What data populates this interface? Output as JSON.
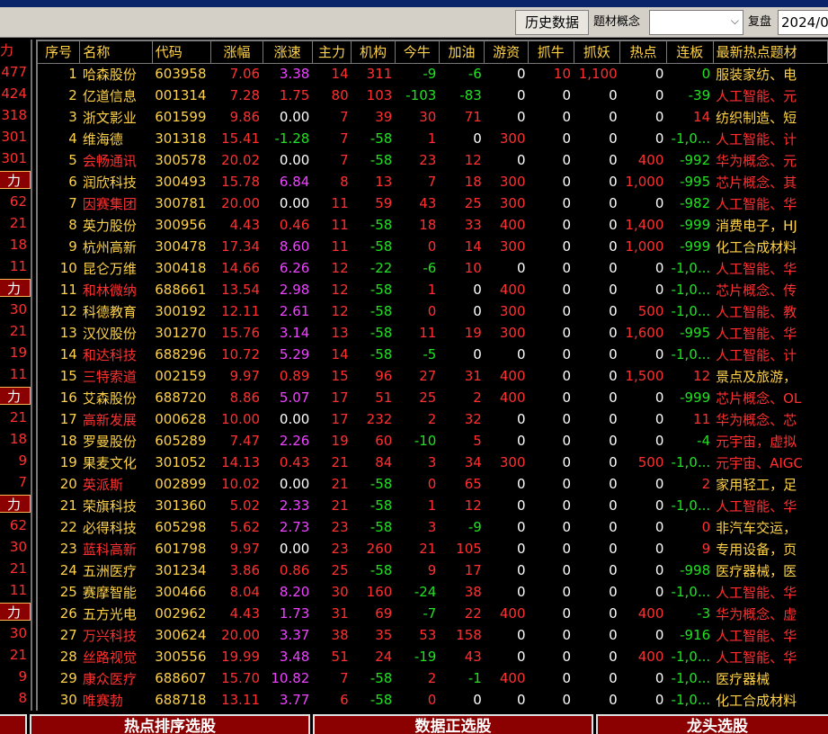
{
  "toolbar": {
    "history_button": "历史数据",
    "theme_label": "题材概念",
    "theme_select_value": "",
    "review_label": "复盘",
    "date_value": "2024/0"
  },
  "left_column": [
    {
      "text": "力",
      "badge": true,
      "top": true
    },
    {
      "text": "477"
    },
    {
      "text": "424"
    },
    {
      "text": "318"
    },
    {
      "text": "301"
    },
    {
      "text": "301"
    },
    {
      "text": "力",
      "badge": true
    },
    {
      "text": "62"
    },
    {
      "text": "21"
    },
    {
      "text": "18"
    },
    {
      "text": "11"
    },
    {
      "text": "力",
      "badge": true
    },
    {
      "text": "30"
    },
    {
      "text": "21"
    },
    {
      "text": "19"
    },
    {
      "text": "11"
    },
    {
      "text": "力",
      "badge": true
    },
    {
      "text": "21"
    },
    {
      "text": "18"
    },
    {
      "text": "9"
    },
    {
      "text": "7"
    },
    {
      "text": "力",
      "badge": true
    },
    {
      "text": "62"
    },
    {
      "text": "30"
    },
    {
      "text": "21"
    },
    {
      "text": "11"
    },
    {
      "text": "力",
      "badge": true
    },
    {
      "text": "30"
    },
    {
      "text": "21"
    },
    {
      "text": "9"
    },
    {
      "text": "8"
    }
  ],
  "table": {
    "headers": [
      "序号",
      "名称",
      "代码",
      "涨幅",
      "涨速",
      "主力",
      "机构",
      "今牛",
      "加油",
      "游资",
      "抓牛",
      "抓妖",
      "热点",
      "连板",
      "最新热点题材"
    ],
    "rows": [
      {
        "idx": "1",
        "name": "哈森股份",
        "nc": "y",
        "code": "603958",
        "chg": "7.06",
        "spd": "3.38",
        "sc": "m",
        "zl": "14",
        "jg": "311",
        "jgc": "r",
        "jn": "-9",
        "jnc": "g",
        "jy": "-6",
        "jyc": "g",
        "yz": "0",
        "zn": "10",
        "znc": "r",
        "zy": "1,100",
        "zyc": "r",
        "rd": "0",
        "lb": "0",
        "lbc": "g",
        "theme": "服装家纺、电",
        "tc": "y"
      },
      {
        "idx": "2",
        "name": "亿道信息",
        "nc": "y",
        "code": "001314",
        "chg": "7.28",
        "spd": "1.75",
        "sc": "r",
        "zl": "80",
        "jg": "103",
        "jgc": "r",
        "jn": "-103",
        "jnc": "g",
        "jy": "-83",
        "jyc": "g",
        "yz": "0",
        "zn": "0",
        "znc": "w",
        "zy": "0",
        "zyc": "w",
        "rd": "0",
        "lb": "-39",
        "lbc": "g",
        "theme": "人工智能、元",
        "tc": "r"
      },
      {
        "idx": "3",
        "name": "浙文影业",
        "nc": "y",
        "code": "601599",
        "chg": "9.86",
        "spd": "0.00",
        "sc": "w",
        "zl": "7",
        "jg": "39",
        "jgc": "r",
        "jn": "30",
        "jnc": "r",
        "jy": "71",
        "jyc": "r",
        "yz": "0",
        "zn": "0",
        "znc": "w",
        "zy": "0",
        "zyc": "w",
        "rd": "0",
        "lb": "14",
        "lbc": "r",
        "theme": "纺织制造、短",
        "tc": "y"
      },
      {
        "idx": "4",
        "name": "维海德",
        "nc": "y",
        "code": "301318",
        "chg": "15.41",
        "spd": "-1.28",
        "sc": "g",
        "zl": "7",
        "jg": "-58",
        "jgc": "g",
        "jn": "1",
        "jnc": "r",
        "jy": "0",
        "jyc": "w",
        "yz": "300",
        "zn": "0",
        "znc": "w",
        "zy": "0",
        "zyc": "w",
        "rd": "0",
        "lb": "-1,0...",
        "lbc": "g",
        "theme": "人工智能、计",
        "tc": "r"
      },
      {
        "idx": "5",
        "name": "会畅通讯",
        "nc": "r",
        "code": "300578",
        "chg": "20.02",
        "spd": "0.00",
        "sc": "w",
        "zl": "7",
        "jg": "-58",
        "jgc": "g",
        "jn": "23",
        "jnc": "r",
        "jy": "12",
        "jyc": "r",
        "yz": "0",
        "zn": "0",
        "znc": "w",
        "zy": "0",
        "zyc": "w",
        "rd": "400",
        "lb": "-992",
        "lbc": "g",
        "theme": "华为概念、元",
        "tc": "r"
      },
      {
        "idx": "6",
        "name": "润欣科技",
        "nc": "y",
        "code": "300493",
        "chg": "15.78",
        "spd": "6.84",
        "sc": "m",
        "zl": "8",
        "jg": "13",
        "jgc": "r",
        "jn": "7",
        "jnc": "r",
        "jy": "18",
        "jyc": "r",
        "yz": "300",
        "zn": "0",
        "znc": "w",
        "zy": "0",
        "zyc": "w",
        "rd": "1,000",
        "lb": "-995",
        "lbc": "g",
        "theme": "芯片概念、其",
        "tc": "r"
      },
      {
        "idx": "7",
        "name": "因赛集团",
        "nc": "r",
        "code": "300781",
        "chg": "20.00",
        "spd": "0.00",
        "sc": "w",
        "zl": "11",
        "jg": "59",
        "jgc": "r",
        "jn": "43",
        "jnc": "r",
        "jy": "25",
        "jyc": "r",
        "yz": "300",
        "zn": "0",
        "znc": "w",
        "zy": "0",
        "zyc": "w",
        "rd": "0",
        "lb": "-982",
        "lbc": "g",
        "theme": "人工智能、华",
        "tc": "r"
      },
      {
        "idx": "8",
        "name": "英力股份",
        "nc": "y",
        "code": "300956",
        "chg": "4.43",
        "spd": "0.46",
        "sc": "r",
        "zl": "11",
        "jg": "-58",
        "jgc": "g",
        "jn": "18",
        "jnc": "r",
        "jy": "33",
        "jyc": "r",
        "yz": "400",
        "zn": "0",
        "znc": "w",
        "zy": "0",
        "zyc": "w",
        "rd": "1,400",
        "lb": "-999",
        "lbc": "g",
        "theme": "消费电子，HJ",
        "tc": "y"
      },
      {
        "idx": "9",
        "name": "杭州高新",
        "nc": "y",
        "code": "300478",
        "chg": "17.34",
        "spd": "8.60",
        "sc": "m",
        "zl": "11",
        "jg": "-58",
        "jgc": "g",
        "jn": "0",
        "jnc": "r",
        "jy": "14",
        "jyc": "r",
        "yz": "300",
        "zn": "0",
        "znc": "w",
        "zy": "0",
        "zyc": "w",
        "rd": "1,000",
        "lb": "-999",
        "lbc": "g",
        "theme": "化工合成材料",
        "tc": "y"
      },
      {
        "idx": "10",
        "name": "昆仑万维",
        "nc": "y",
        "code": "300418",
        "chg": "14.66",
        "spd": "6.26",
        "sc": "m",
        "zl": "12",
        "jg": "-22",
        "jgc": "g",
        "jn": "-6",
        "jnc": "g",
        "jy": "10",
        "jyc": "r",
        "yz": "0",
        "zn": "0",
        "znc": "w",
        "zy": "0",
        "zyc": "w",
        "rd": "0",
        "lb": "-1,0...",
        "lbc": "g",
        "theme": "人工智能、华",
        "tc": "r"
      },
      {
        "idx": "11",
        "name": "和林微纳",
        "nc": "r",
        "code": "688661",
        "chg": "13.54",
        "spd": "2.98",
        "sc": "m",
        "zl": "12",
        "jg": "-58",
        "jgc": "g",
        "jn": "1",
        "jnc": "r",
        "jy": "0",
        "jyc": "w",
        "yz": "400",
        "zn": "0",
        "znc": "w",
        "zy": "0",
        "zyc": "w",
        "rd": "0",
        "lb": "-1,0...",
        "lbc": "g",
        "theme": "芯片概念、传",
        "tc": "r"
      },
      {
        "idx": "12",
        "name": "科德教育",
        "nc": "y",
        "code": "300192",
        "chg": "12.11",
        "spd": "2.61",
        "sc": "m",
        "zl": "12",
        "jg": "-58",
        "jgc": "g",
        "jn": "0",
        "jnc": "r",
        "jy": "0",
        "jyc": "w",
        "yz": "300",
        "zn": "0",
        "znc": "w",
        "zy": "0",
        "zyc": "w",
        "rd": "500",
        "lb": "-1,0...",
        "lbc": "g",
        "theme": "人工智能、教",
        "tc": "r"
      },
      {
        "idx": "13",
        "name": "汉仪股份",
        "nc": "y",
        "code": "301270",
        "chg": "15.76",
        "spd": "3.14",
        "sc": "m",
        "zl": "13",
        "jg": "-58",
        "jgc": "g",
        "jn": "11",
        "jnc": "r",
        "jy": "19",
        "jyc": "r",
        "yz": "300",
        "zn": "0",
        "znc": "w",
        "zy": "0",
        "zyc": "w",
        "rd": "1,600",
        "lb": "-995",
        "lbc": "g",
        "theme": "人工智能、华",
        "tc": "r"
      },
      {
        "idx": "14",
        "name": "和达科技",
        "nc": "r",
        "code": "688296",
        "chg": "10.72",
        "spd": "5.29",
        "sc": "m",
        "zl": "14",
        "jg": "-58",
        "jgc": "g",
        "jn": "-5",
        "jnc": "g",
        "jy": "0",
        "jyc": "w",
        "yz": "0",
        "zn": "0",
        "znc": "w",
        "zy": "0",
        "zyc": "w",
        "rd": "0",
        "lb": "-1,0...",
        "lbc": "g",
        "theme": "人工智能、计",
        "tc": "r"
      },
      {
        "idx": "15",
        "name": "三特索道",
        "nc": "r",
        "code": "002159",
        "chg": "9.97",
        "spd": "0.89",
        "sc": "r",
        "zl": "15",
        "jg": "96",
        "jgc": "r",
        "jn": "27",
        "jnc": "r",
        "jy": "31",
        "jyc": "r",
        "yz": "400",
        "zn": "0",
        "znc": "w",
        "zy": "0",
        "zyc": "w",
        "rd": "1,500",
        "lb": "12",
        "lbc": "r",
        "theme": "景点及旅游，",
        "tc": "y"
      },
      {
        "idx": "16",
        "name": "艾森股份",
        "nc": "y",
        "code": "688720",
        "chg": "8.86",
        "spd": "5.07",
        "sc": "m",
        "zl": "17",
        "jg": "51",
        "jgc": "r",
        "jn": "25",
        "jnc": "r",
        "jy": "2",
        "jyc": "r",
        "yz": "400",
        "zn": "0",
        "znc": "w",
        "zy": "0",
        "zyc": "w",
        "rd": "0",
        "lb": "-999",
        "lbc": "g",
        "theme": "芯片概念、OL",
        "tc": "r"
      },
      {
        "idx": "17",
        "name": "高新发展",
        "nc": "r",
        "code": "000628",
        "chg": "10.00",
        "spd": "0.00",
        "sc": "w",
        "zl": "17",
        "jg": "232",
        "jgc": "r",
        "jn": "2",
        "jnc": "r",
        "jy": "32",
        "jyc": "r",
        "yz": "0",
        "zn": "0",
        "znc": "w",
        "zy": "0",
        "zyc": "w",
        "rd": "0",
        "lb": "11",
        "lbc": "r",
        "theme": "华为概念、芯",
        "tc": "r"
      },
      {
        "idx": "18",
        "name": "罗曼股份",
        "nc": "y",
        "code": "605289",
        "chg": "7.47",
        "spd": "2.26",
        "sc": "m",
        "zl": "19",
        "jg": "60",
        "jgc": "r",
        "jn": "-10",
        "jnc": "g",
        "jy": "5",
        "jyc": "r",
        "yz": "0",
        "zn": "0",
        "znc": "w",
        "zy": "0",
        "zyc": "w",
        "rd": "0",
        "lb": "-4",
        "lbc": "g",
        "theme": "元宇宙，虚拟",
        "tc": "r"
      },
      {
        "idx": "19",
        "name": "果麦文化",
        "nc": "y",
        "code": "301052",
        "chg": "14.13",
        "spd": "0.43",
        "sc": "r",
        "zl": "21",
        "jg": "84",
        "jgc": "r",
        "jn": "3",
        "jnc": "r",
        "jy": "34",
        "jyc": "r",
        "yz": "300",
        "zn": "0",
        "znc": "w",
        "zy": "0",
        "zyc": "w",
        "rd": "500",
        "lb": "-1,0...",
        "lbc": "g",
        "theme": "元宇宙、AIGC",
        "tc": "r"
      },
      {
        "idx": "20",
        "name": "英派斯",
        "nc": "r",
        "code": "002899",
        "chg": "10.02",
        "spd": "0.00",
        "sc": "w",
        "zl": "21",
        "jg": "-58",
        "jgc": "g",
        "jn": "0",
        "jnc": "r",
        "jy": "65",
        "jyc": "r",
        "yz": "0",
        "zn": "0",
        "znc": "w",
        "zy": "0",
        "zyc": "w",
        "rd": "0",
        "lb": "2",
        "lbc": "r",
        "theme": "家用轻工，足",
        "tc": "y"
      },
      {
        "idx": "21",
        "name": "荣旗科技",
        "nc": "y",
        "code": "301360",
        "chg": "5.02",
        "spd": "2.33",
        "sc": "m",
        "zl": "21",
        "jg": "-58",
        "jgc": "g",
        "jn": "1",
        "jnc": "r",
        "jy": "12",
        "jyc": "r",
        "yz": "0",
        "zn": "0",
        "znc": "w",
        "zy": "0",
        "zyc": "w",
        "rd": "0",
        "lb": "-1,0...",
        "lbc": "g",
        "theme": "人工智能、华",
        "tc": "r"
      },
      {
        "idx": "22",
        "name": "必得科技",
        "nc": "y",
        "code": "605298",
        "chg": "5.62",
        "spd": "2.73",
        "sc": "m",
        "zl": "23",
        "jg": "-58",
        "jgc": "g",
        "jn": "3",
        "jnc": "r",
        "jy": "-9",
        "jyc": "g",
        "yz": "0",
        "zn": "0",
        "znc": "w",
        "zy": "0",
        "zyc": "w",
        "rd": "0",
        "lb": "0",
        "lbc": "r",
        "theme": "非汽车交运，",
        "tc": "y"
      },
      {
        "idx": "23",
        "name": "蓝科高新",
        "nc": "r",
        "code": "601798",
        "chg": "9.97",
        "spd": "0.00",
        "sc": "w",
        "zl": "23",
        "jg": "260",
        "jgc": "r",
        "jn": "21",
        "jnc": "r",
        "jy": "105",
        "jyc": "r",
        "yz": "0",
        "zn": "0",
        "znc": "w",
        "zy": "0",
        "zyc": "w",
        "rd": "0",
        "lb": "9",
        "lbc": "r",
        "theme": "专用设备，页",
        "tc": "y"
      },
      {
        "idx": "24",
        "name": "五洲医疗",
        "nc": "y",
        "code": "301234",
        "chg": "3.86",
        "spd": "0.86",
        "sc": "r",
        "zl": "25",
        "jg": "-58",
        "jgc": "g",
        "jn": "9",
        "jnc": "r",
        "jy": "17",
        "jyc": "r",
        "yz": "0",
        "zn": "0",
        "znc": "w",
        "zy": "0",
        "zyc": "w",
        "rd": "0",
        "lb": "-998",
        "lbc": "g",
        "theme": "医疗器械，医",
        "tc": "y"
      },
      {
        "idx": "25",
        "name": "赛摩智能",
        "nc": "y",
        "code": "300466",
        "chg": "8.04",
        "spd": "8.20",
        "sc": "m",
        "zl": "30",
        "jg": "160",
        "jgc": "r",
        "jn": "-24",
        "jnc": "g",
        "jy": "38",
        "jyc": "r",
        "yz": "0",
        "zn": "0",
        "znc": "w",
        "zy": "0",
        "zyc": "w",
        "rd": "0",
        "lb": "-1,0...",
        "lbc": "g",
        "theme": "人工智能、华",
        "tc": "r"
      },
      {
        "idx": "26",
        "name": "五方光电",
        "nc": "y",
        "code": "002962",
        "chg": "4.43",
        "spd": "1.73",
        "sc": "m",
        "zl": "31",
        "jg": "69",
        "jgc": "r",
        "jn": "-7",
        "jnc": "g",
        "jy": "22",
        "jyc": "r",
        "yz": "400",
        "zn": "0",
        "znc": "w",
        "zy": "0",
        "zyc": "w",
        "rd": "400",
        "lb": "-3",
        "lbc": "g",
        "theme": "华为概念、虚",
        "tc": "r"
      },
      {
        "idx": "27",
        "name": "万兴科技",
        "nc": "r",
        "code": "300624",
        "chg": "20.00",
        "spd": "3.37",
        "sc": "m",
        "zl": "38",
        "jg": "35",
        "jgc": "r",
        "jn": "53",
        "jnc": "r",
        "jy": "158",
        "jyc": "r",
        "yz": "0",
        "zn": "0",
        "znc": "w",
        "zy": "0",
        "zyc": "w",
        "rd": "0",
        "lb": "-916",
        "lbc": "g",
        "theme": "人工智能、华",
        "tc": "r"
      },
      {
        "idx": "28",
        "name": "丝路视觉",
        "nc": "r",
        "code": "300556",
        "chg": "19.99",
        "spd": "3.48",
        "sc": "m",
        "zl": "51",
        "jg": "24",
        "jgc": "r",
        "jn": "-19",
        "jnc": "g",
        "jy": "43",
        "jyc": "r",
        "yz": "0",
        "zn": "0",
        "znc": "w",
        "zy": "0",
        "zyc": "w",
        "rd": "400",
        "lb": "-1,0...",
        "lbc": "g",
        "theme": "人工智能、华",
        "tc": "r"
      },
      {
        "idx": "29",
        "name": "康众医疗",
        "nc": "r",
        "code": "688607",
        "chg": "15.70",
        "spd": "10.82",
        "sc": "m",
        "zl": "7",
        "jg": "-58",
        "jgc": "g",
        "jn": "2",
        "jnc": "r",
        "jy": "-1",
        "jyc": "g",
        "yz": "400",
        "zn": "0",
        "znc": "w",
        "zy": "0",
        "zyc": "w",
        "rd": "0",
        "lb": "-1,0...",
        "lbc": "g",
        "theme": "医疗器械",
        "tc": "y"
      },
      {
        "idx": "30",
        "name": "唯赛勃",
        "nc": "r",
        "code": "688718",
        "chg": "13.11",
        "spd": "3.77",
        "sc": "m",
        "zl": "6",
        "jg": "-58",
        "jgc": "g",
        "jn": "0",
        "jnc": "r",
        "jy": "0",
        "jyc": "w",
        "yz": "0",
        "zn": "0",
        "znc": "w",
        "zy": "0",
        "zyc": "w",
        "rd": "0",
        "lb": "-1,0...",
        "lbc": "g",
        "theme": "化工合成材料",
        "tc": "y"
      }
    ]
  },
  "bottom_buttons": [
    "热点排序选股",
    "数据正选股",
    "龙头选股"
  ]
}
